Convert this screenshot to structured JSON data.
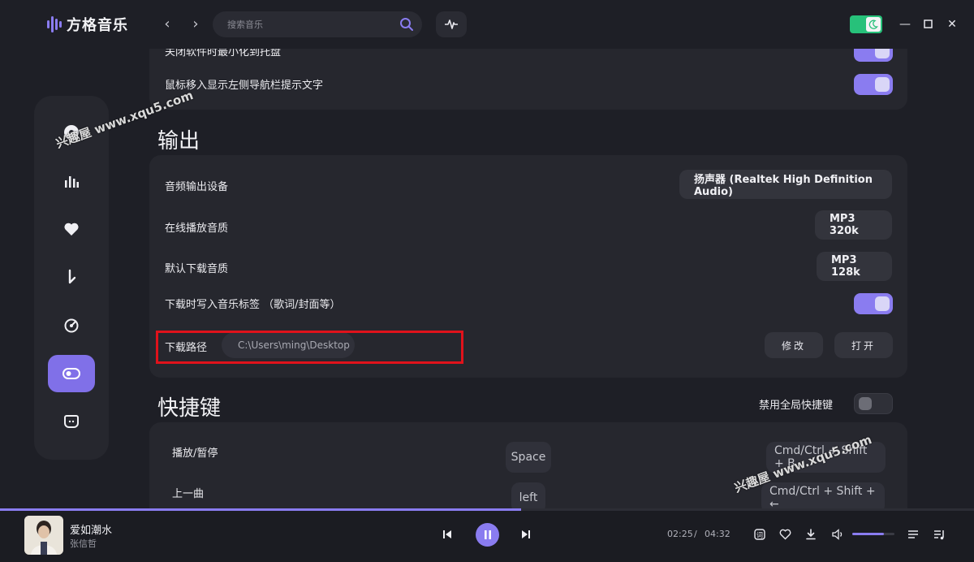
{
  "app": {
    "title": "方格音乐"
  },
  "search": {
    "placeholder": "搜索音乐"
  },
  "settings": {
    "general_rows": [
      {
        "label": "关闭软件时最小化到托盘",
        "toggle": "on"
      },
      {
        "label": "鼠标移入显示左侧导航栏提示文字",
        "toggle": "on"
      }
    ],
    "output": {
      "title": "输出",
      "device_label": "音频输出设备",
      "device_value": "扬声器 (Realtek High Definition Audio)",
      "online_quality_label": "在线播放音质",
      "online_quality_value": "MP3 320k",
      "download_quality_label": "默认下载音质",
      "download_quality_value": "MP3 128k",
      "write_tags_label": "下载时写入音乐标签 （歌词/封面等）",
      "write_tags_toggle": "on",
      "download_path_label": "下载路径",
      "download_path_value": "C:\\Users\\ming\\Desktop",
      "modify_label": "修改",
      "open_label": "打开"
    },
    "shortcuts": {
      "title": "快捷键",
      "disable_global_label": "禁用全局快捷键",
      "disable_global_toggle": "off",
      "rows": [
        {
          "action": "播放/暂停",
          "local": "Space",
          "global": "Cmd/Ctrl + Shift + B"
        },
        {
          "action": "上一曲",
          "local": "left",
          "global": "Cmd/Ctrl + Shift + ←"
        }
      ]
    }
  },
  "watermark": {
    "text": "兴趣屋 www.xqu5.com"
  },
  "player": {
    "song_title": "爱如潮水",
    "artist": "张信哲",
    "current_time": "02:25",
    "separator": "/",
    "total_time": "04:32",
    "progress": 0.535,
    "volume": 0.75
  },
  "colors": {
    "accent": "#8a7cf0",
    "theme_toggle": "#27c17a",
    "highlight_box": "#e0121b"
  }
}
